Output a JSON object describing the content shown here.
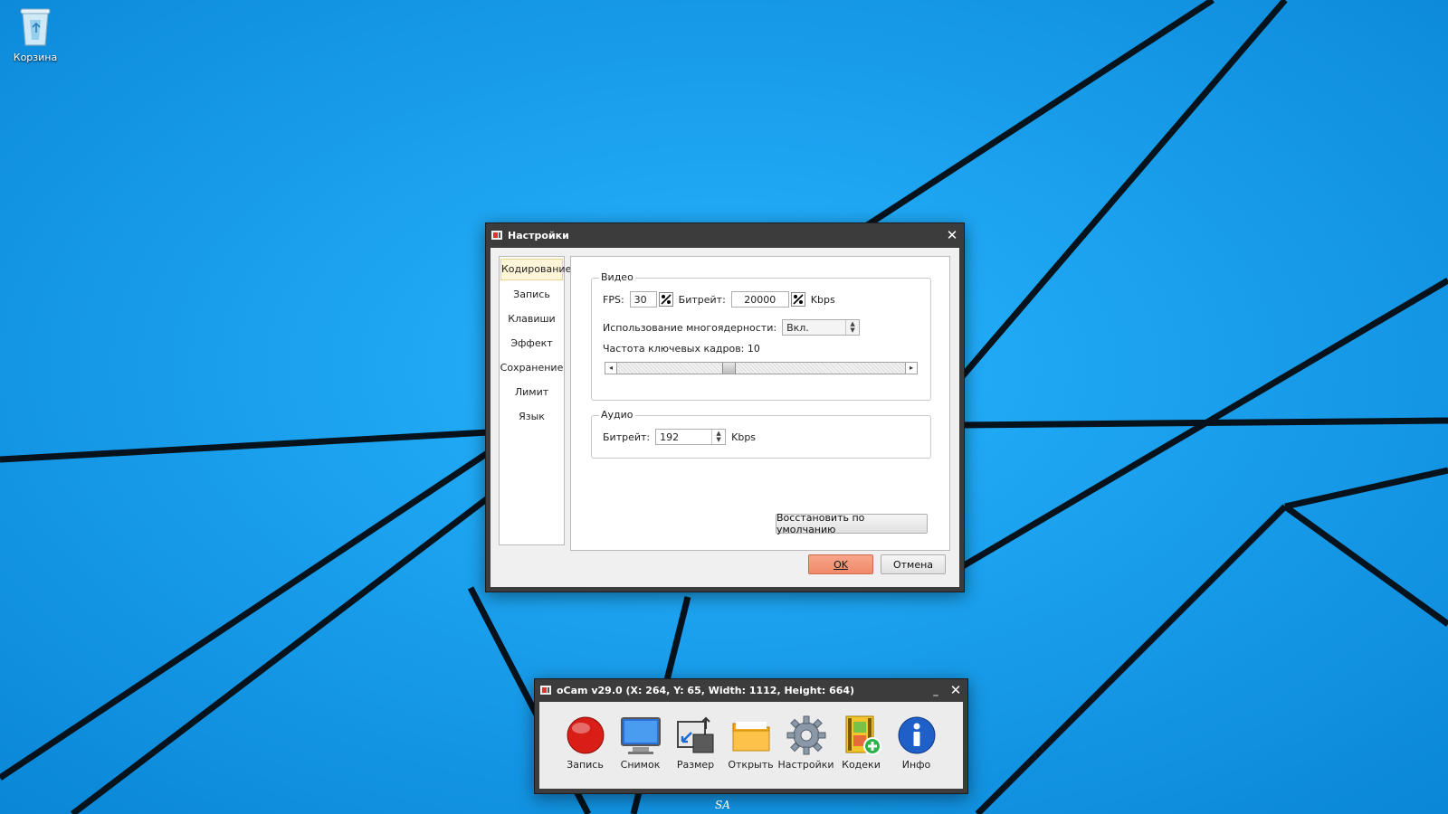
{
  "desktop": {
    "recycle_bin_label": "Корзина"
  },
  "settings_dialog": {
    "title": "Настройки",
    "nav": [
      "Кодирование",
      "Запись",
      "Клавиши",
      "Эффект",
      "Сохранение",
      "Лимит",
      "Язык"
    ],
    "active_nav": "Кодирование",
    "video": {
      "group_title": "Видео",
      "fps_label": "FPS:",
      "fps_value": "30",
      "bitrate_label": "Битрейт:",
      "bitrate_value": "20000",
      "bitrate_unit": "Kbps",
      "multicore_label": "Использование многоядерности:",
      "multicore_value": "Вкл.",
      "keyframe_label": "Частота ключевых кадров: 10",
      "keyframe_slider_fraction": 0.38
    },
    "audio": {
      "group_title": "Аудио",
      "bitrate_label": "Битрейт:",
      "bitrate_value": "192",
      "bitrate_unit": "Kbps"
    },
    "restore_defaults_label": "Восстановить по умолчанию",
    "ok_label": "OK",
    "cancel_label": "Отмена"
  },
  "ocam": {
    "title": "oCam v29.0 (X: 264, Y: 65, Width: 1112, Height: 664)",
    "tools": [
      "Запись",
      "Снимок",
      "Размер",
      "Открыть",
      "Настройки",
      "Кодеки",
      "Инфо"
    ]
  },
  "taskbar": {
    "label": "SA"
  }
}
